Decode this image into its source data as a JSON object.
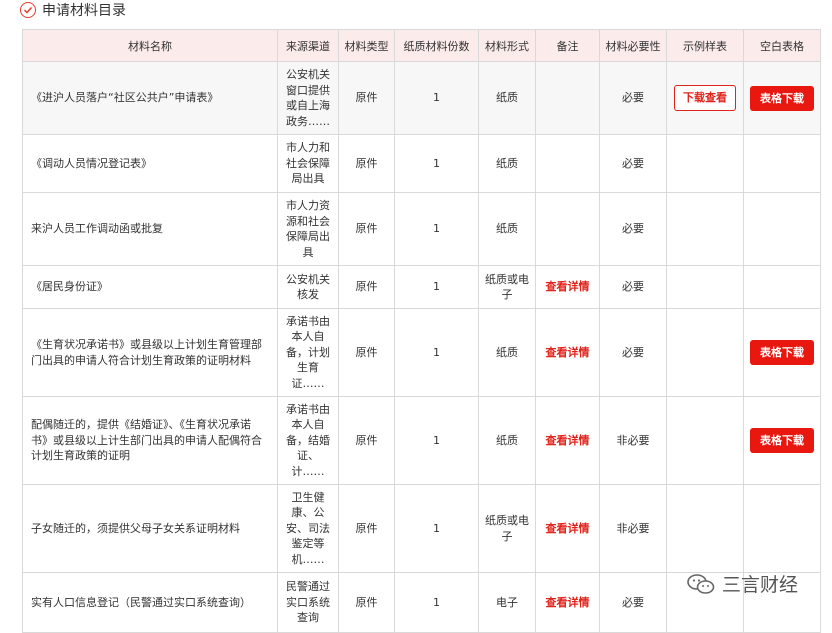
{
  "section": {
    "title": "申请材料目录",
    "icon": "check-circle-icon",
    "accent": "#e23b2e"
  },
  "table": {
    "headers": [
      "材料名称",
      "来源渠道",
      "材料类型",
      "纸质材料份数",
      "材料形式",
      "备注",
      "材料必要性",
      "示例样表",
      "空白表格"
    ],
    "rows": [
      {
        "name": "《进沪人员落户“社区公共户”申请表》",
        "source": "公安机关窗口提供或自上海政务……",
        "type": "原件",
        "copies": "1",
        "form": "纸质",
        "note": "",
        "necessity": "必要",
        "sample": "下载查看",
        "blank": "表格下载"
      },
      {
        "name": "《调动人员情况登记表》",
        "source": "市人力和社会保障局出具",
        "type": "原件",
        "copies": "1",
        "form": "纸质",
        "note": "",
        "necessity": "必要",
        "sample": "",
        "blank": ""
      },
      {
        "name": "来沪人员工作调动函或批复",
        "source": "市人力资源和社会保障局出具",
        "type": "原件",
        "copies": "1",
        "form": "纸质",
        "note": "",
        "necessity": "必要",
        "sample": "",
        "blank": ""
      },
      {
        "name": "《居民身份证》",
        "source": "公安机关核发",
        "type": "原件",
        "copies": "1",
        "form": "纸质或电子",
        "note": "查看详情",
        "necessity": "必要",
        "sample": "",
        "blank": ""
      },
      {
        "name": "《生育状况承诺书》或县级以上计划生育管理部门出具的申请人符合计划生育政策的证明材料",
        "source": "承诺书由本人自备，计划生育证……",
        "type": "原件",
        "copies": "1",
        "form": "纸质",
        "note": "查看详情",
        "necessity": "必要",
        "sample": "",
        "blank": "表格下载"
      },
      {
        "name": "配偶随迁的，提供《结婚证》、《生育状况承诺书》或县级以上计生部门出具的申请人配偶符合计划生育政策的证明",
        "source": "承诺书由本人自备，结婚证、计……",
        "type": "原件",
        "copies": "1",
        "form": "纸质",
        "note": "查看详情",
        "necessity": "非必要",
        "sample": "",
        "blank": "表格下载"
      },
      {
        "name": "子女随迁的，须提供父母子女关系证明材料",
        "source": "卫生健康、公安、司法鉴定等机……",
        "type": "原件",
        "copies": "1",
        "form": "纸质或电子",
        "note": "查看详情",
        "necessity": "非必要",
        "sample": "",
        "blank": ""
      },
      {
        "name": "实有人口信息登记（民警通过实口系统查询）",
        "source": "民警通过实口系统查询",
        "type": "原件",
        "copies": "1",
        "form": "电子",
        "note": "查看详情",
        "necessity": "必要",
        "sample": "",
        "blank": ""
      }
    ]
  },
  "watermark": {
    "text": "三言财经",
    "icon": "wechat-icon"
  }
}
